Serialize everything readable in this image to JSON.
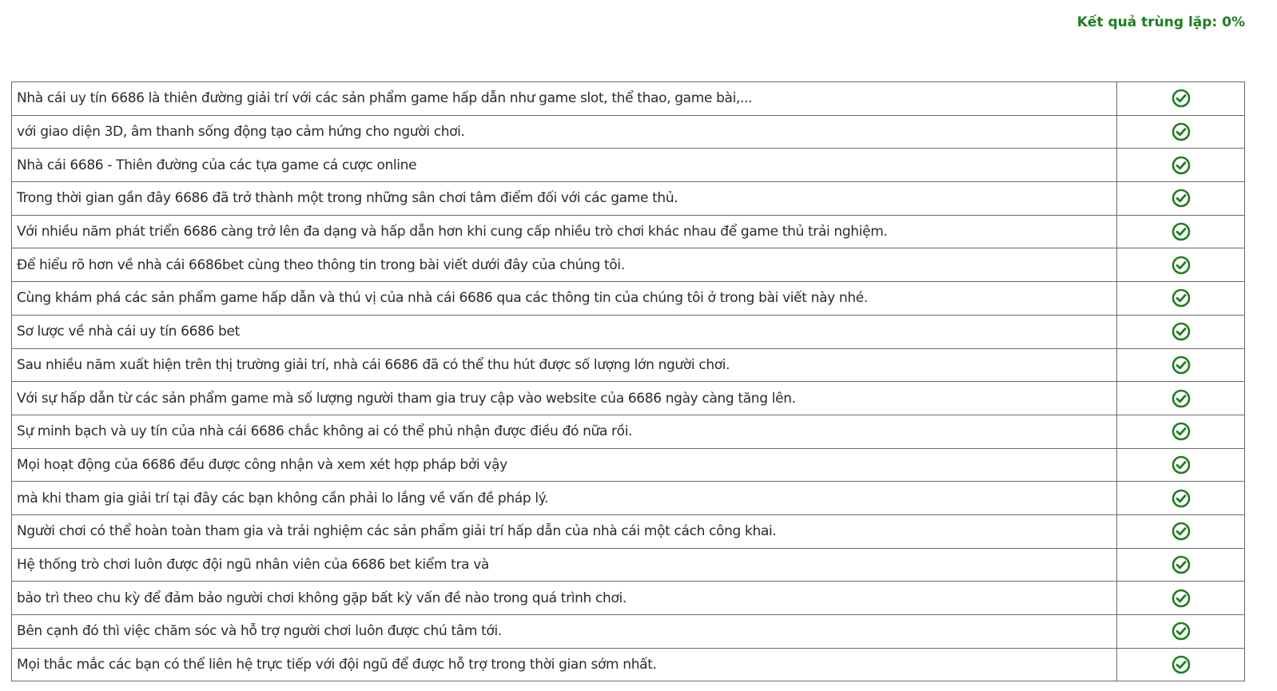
{
  "header": {
    "result_label": "Kết quả trùng lặp: 0%"
  },
  "colors": {
    "accent_green": "#1e7e1e",
    "border": "#6b6b6b",
    "text": "#2b2b2b"
  },
  "rows": [
    {
      "text": "Nhà cái uy tín 6686 là thiên đường giải trí với các sản phẩm game hấp dẫn như game slot, thể thao, game bài,...",
      "status_icon": "check-circle-icon"
    },
    {
      "text": "với giao diện 3D, âm thanh sống động tạo cảm hứng cho người chơi.",
      "status_icon": "check-circle-icon"
    },
    {
      "text": "Nhà cái 6686 - Thiên đường của các tựa game cá cược online",
      "status_icon": "check-circle-icon"
    },
    {
      "text": "Trong thời gian gần đây 6686 đã trở thành một trong những sân chơi tâm điểm đối với các game thủ.",
      "status_icon": "check-circle-icon"
    },
    {
      "text": "Với nhiều năm phát triển 6686 càng trở lên đa dạng và hấp dẫn hơn khi cung cấp nhiều trò chơi khác nhau để game thủ trải nghiệm.",
      "status_icon": "check-circle-icon"
    },
    {
      "text": "Để hiểu rõ hơn về nhà cái 6686bet cùng theo thông tin trong bài viết dưới đây của chúng tôi.",
      "status_icon": "check-circle-icon"
    },
    {
      "text": "Cùng khám phá các sản phẩm game hấp dẫn và thú vị của nhà cái 6686 qua các thông tin của chúng tôi ở trong bài viết này nhé.",
      "status_icon": "check-circle-icon"
    },
    {
      "text": "Sơ lược về nhà cái uy tín 6686 bet",
      "status_icon": "check-circle-icon"
    },
    {
      "text": "Sau nhiều năm xuất hiện trên thị trường giải trí, nhà cái 6686 đã có thể thu hút được số lượng lớn người chơi.",
      "status_icon": "check-circle-icon"
    },
    {
      "text": "Với sự hấp dẫn từ các sản phẩm game mà số lượng người tham gia truy cập vào website của 6686 ngày càng tăng lên.",
      "status_icon": "check-circle-icon"
    },
    {
      "text": "Sự minh bạch và uy tín của nhà cái 6686 chắc không ai có thể phủ nhận được điều đó nữa rồi.",
      "status_icon": "check-circle-icon"
    },
    {
      "text": "Mọi hoạt động của 6686 đều được công nhận và xem xét hợp pháp bởi vậy",
      "status_icon": "check-circle-icon"
    },
    {
      "text": "mà khi tham gia giải trí tại đây các bạn không cần phải lo lắng về vấn đề pháp lý.",
      "status_icon": "check-circle-icon"
    },
    {
      "text": "Người chơi có thể hoàn toàn tham gia và trải nghiệm các sản phẩm giải trí hấp dẫn của nhà cái một cách công khai.",
      "status_icon": "check-circle-icon"
    },
    {
      "text": "Hệ thống trò chơi luôn được đội ngũ nhân viên của 6686 bet kiểm tra và",
      "status_icon": "check-circle-icon"
    },
    {
      "text": "bảo trì theo chu kỳ để đảm bảo người chơi không gặp bất kỳ vấn đề nào trong quá trình chơi.",
      "status_icon": "check-circle-icon"
    },
    {
      "text": "Bên cạnh đó thì việc chăm sóc và hỗ trợ người chơi luôn được chú tâm tới.",
      "status_icon": "check-circle-icon"
    },
    {
      "text": "Mọi thắc mắc các  bạn có thể liên hệ trực tiếp với đội ngũ để được hỗ trợ trong thời gian sớm nhất.",
      "status_icon": "check-circle-icon"
    }
  ]
}
